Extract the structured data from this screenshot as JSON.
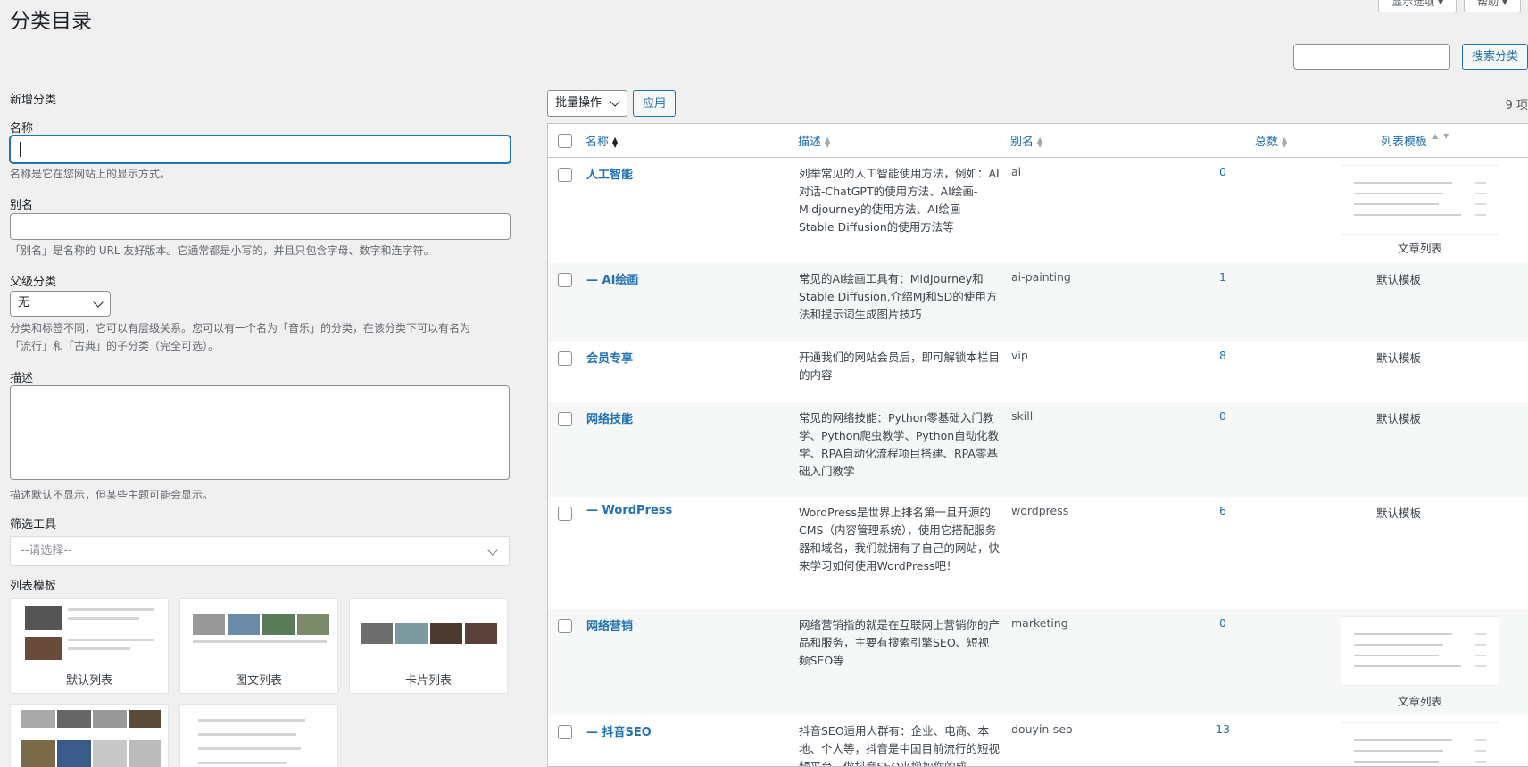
{
  "top_tabs": [
    "显示选项 ▾",
    "帮助 ▾"
  ],
  "page_title": "分类目录",
  "search": {
    "placeholder": "",
    "button": "搜索分类"
  },
  "form": {
    "heading": "新增分类",
    "name_label": "名称",
    "name_value": "",
    "name_hint": "名称是它在您网站上的显示方式。",
    "slug_label": "别名",
    "slug_value": "",
    "slug_hint": "「别名」是名称的 URL 友好版本。它通常都是小写的，并且只包含字母、数字和连字符。",
    "parent_label": "父级分类",
    "parent_value": "无",
    "parent_hint_1": "分类和标签不同，它可以有层级关系。您可以有一个名为「音乐」的分类，在该分类下可以有名为",
    "parent_hint_2": "「流行」和「古典」的子分类（完全可选）。",
    "desc_label": "描述",
    "desc_hint": "描述默认不显示，但某些主题可能会显示。",
    "filter_label": "筛选工具",
    "filter_placeholder": "--请选择--",
    "template_label": "列表模板",
    "templates": [
      "默认列表",
      "图文列表",
      "卡片列表"
    ]
  },
  "toolbar": {
    "bulk": "批量操作",
    "apply": "应用",
    "count": "9 项"
  },
  "table": {
    "columns": [
      "名称",
      "描述",
      "别名",
      "总数",
      "列表模板"
    ],
    "rows": [
      {
        "name": "人工智能",
        "desc": "列举常见的人工智能使用方法，例如：AI对话-ChatGPT的使用方法、AI绘画-Midjourney的使用方法、AI绘画-Stable Diffusion的使用方法等",
        "slug": "ai",
        "count": "0",
        "template": "文章列表"
      },
      {
        "name": "— AI绘画",
        "desc": "常见的AI绘画工具有：MidJourney和Stable Diffusion,介绍MJ和SD的使用方法和提示词生成图片技巧",
        "slug": "ai-painting",
        "count": "1",
        "template": "默认模板"
      },
      {
        "name": "会员专享",
        "desc": "开通我们的网站会员后，即可解锁本栏目的内容",
        "slug": "vip",
        "count": "8",
        "template": "默认模板"
      },
      {
        "name": "网络技能",
        "desc": "常见的网络技能：Python零基础入门教学、Python爬虫教学、Python自动化教学、RPA自动化流程项目搭建、RPA零基础入门教学",
        "slug": "skill",
        "count": "0",
        "template": "默认模板"
      },
      {
        "name": "— WordPress",
        "desc": "WordPress是世界上排名第一且开源的CMS（内容管理系统），使用它搭配服务器和域名，我们就拥有了自己的网站，快来学习如何使用WordPress吧！",
        "slug": "wordpress",
        "count": "6",
        "template": "默认模板"
      },
      {
        "name": "网络营销",
        "desc": "网络营销指的就是在互联网上营销你的产品和服务，主要有搜索引擎SEO、短视频SEO等",
        "slug": "marketing",
        "count": "0",
        "template": "文章列表"
      },
      {
        "name": "— 抖音SEO",
        "desc": "抖音SEO适用人群有：企业、电商、本地、个人等，抖音是中国目前流行的短视频平台，做抖音SEO来增加你的成",
        "slug": "douyin-seo",
        "count": "13",
        "template": ""
      }
    ]
  }
}
